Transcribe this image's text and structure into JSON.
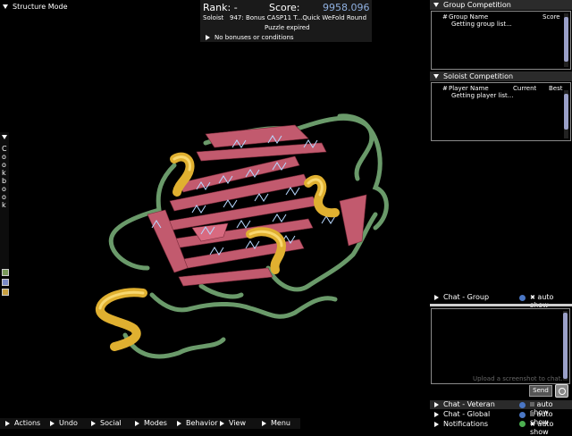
{
  "mode": "Structure Mode",
  "score_box": {
    "rank_label": "Rank:",
    "rank_value": "-",
    "score_label": "Score:",
    "score_value": "9958.096",
    "soloist": "Soloist",
    "puzzle": "947: Bonus CASP11 T...Quick WeFold Round",
    "status": "Puzzle expired",
    "bonuses": "No bonuses or conditions"
  },
  "cookbook": {
    "label": "Cookbook"
  },
  "group_panel": {
    "title": "Group Competition",
    "col_rank": "#",
    "col_name": "Group Name",
    "col_score": "Score",
    "loading": "Getting group list..."
  },
  "solo_panel": {
    "title": "Soloist Competition",
    "col_rank": "#",
    "col_name": "Player Name",
    "col_current": "Current",
    "col_best": "Best",
    "loading": "Getting player list..."
  },
  "chat": {
    "group_tab": "Chat - Group",
    "auto_show": "auto show",
    "placeholder": "Upload a screenshot to chat...",
    "send": "Send",
    "veteran": "Chat - Veteran",
    "global": "Chat - Global",
    "notifications": "Notifications"
  },
  "menu": [
    "Actions",
    "Undo",
    "Social",
    "Modes",
    "Behavior",
    "View",
    "Menu"
  ],
  "colors": {
    "sheet": "#c25a6e",
    "helix": "#e0b030",
    "loop": "#6a9a6a",
    "hbond": "#b8d8ff",
    "score": "#8fb0e0"
  }
}
